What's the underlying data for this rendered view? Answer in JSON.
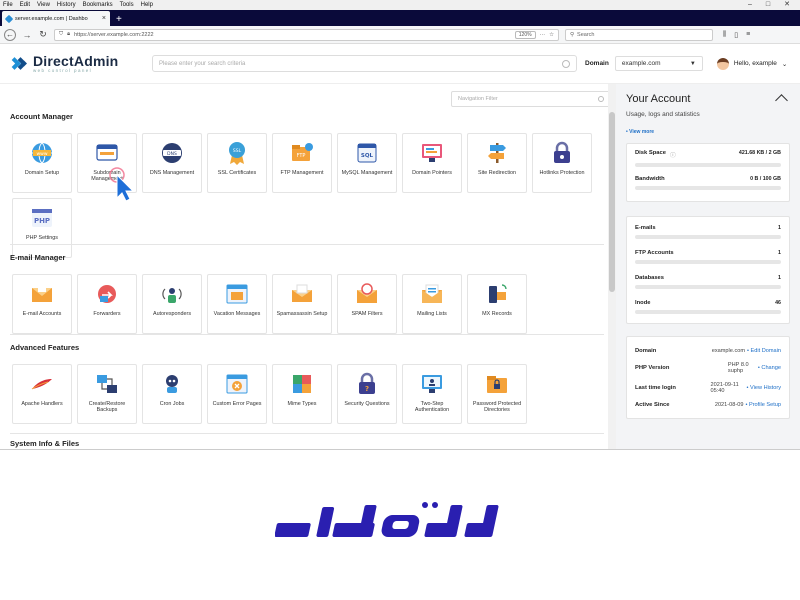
{
  "browser": {
    "menu": [
      "File",
      "Edit",
      "View",
      "History",
      "Bookmarks",
      "Tools",
      "Help"
    ],
    "tab_title": "server.example.com | Dashbo",
    "url": "https://server.example.com:2222",
    "zoom": "120%",
    "search_placeholder": "Search"
  },
  "header": {
    "logo_name": "DirectAdmin",
    "logo_sub": "web control panel",
    "search_placeholder": "Please enter your search criteria",
    "domain_label": "Domain",
    "domain_value": "example.com",
    "greeting": "Hello, example"
  },
  "main": {
    "nav_filter_placeholder": "Navigation Filter",
    "sections": [
      {
        "title": "Account Manager",
        "items": [
          "Domain Setup",
          "Subdomain Management",
          "DNS Management",
          "SSL Certificates",
          "FTP Management",
          "MySQL Management",
          "Domain Pointers",
          "Site Redirection",
          "Hotlinks Protection",
          "PHP Settings"
        ]
      },
      {
        "title": "E-mail Manager",
        "items": [
          "E-mail Accounts",
          "Forwarders",
          "Autoresponders",
          "Vacation Messages",
          "Spamassassin Setup",
          "SPAM Filters",
          "Mailing Lists",
          "MX Records"
        ]
      },
      {
        "title": "Advanced Features",
        "items": [
          "Apache Handlers",
          "Create/Restore Backups",
          "Cron Jobs",
          "Custom Error Pages",
          "Mime Types",
          "Security Questions",
          "Two-Step Authentication",
          "Password Protected Directories"
        ]
      },
      {
        "title": "System Info & Files",
        "items": []
      }
    ]
  },
  "panel": {
    "title": "Your Account",
    "subtitle": "Usage, logs and statistics",
    "view_more": "• View more",
    "usage": [
      {
        "label": "Disk Space",
        "value": "421.68 KB / 2 GB"
      },
      {
        "label": "Bandwidth",
        "value": "0 B / 100 GB"
      }
    ],
    "counts": [
      {
        "label": "E-mails",
        "value": "1"
      },
      {
        "label": "FTP Accounts",
        "value": "1"
      },
      {
        "label": "Databases",
        "value": "1"
      },
      {
        "label": "Inode",
        "value": "46"
      }
    ],
    "info": [
      {
        "label": "Domain",
        "value": "example.com",
        "action": "• Edit Domain"
      },
      {
        "label": "PHP Version",
        "value": "PHP 8.0 suphp",
        "action": "• Change"
      },
      {
        "label": "Last time login",
        "value": "2021-09-11 05:40",
        "action": "• View History"
      },
      {
        "label": "Active Since",
        "value": "2021-08-09",
        "action": "• Profile Setup"
      }
    ]
  },
  "colors": {
    "accent": "#1e6fc7",
    "brand_blue": "#2a1fb0",
    "tab_strip": "#0a0a3a"
  }
}
